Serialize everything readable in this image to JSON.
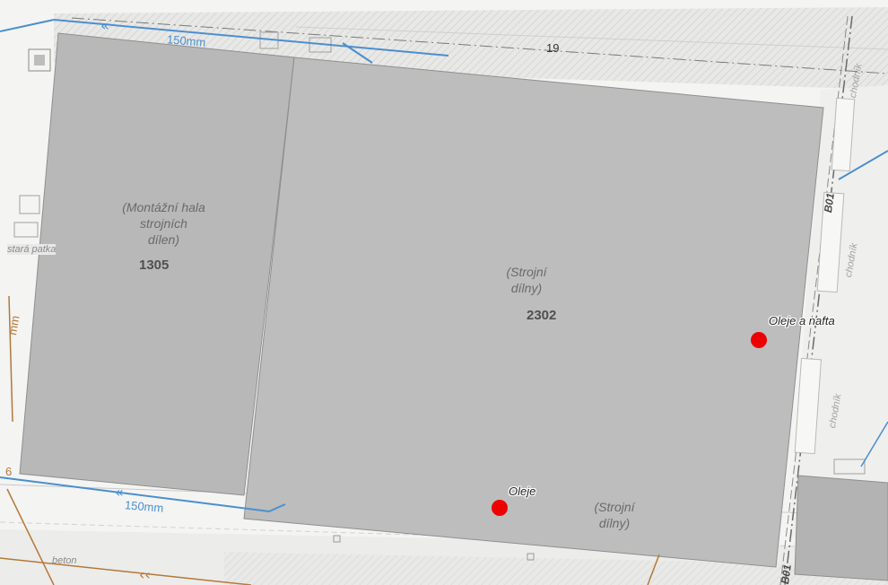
{
  "map": {
    "colors": {
      "background": "#f4f4f2",
      "building": "#b8b8b8",
      "building_edge": "#8f8f8f",
      "pipe_water": "#4a8fd0",
      "pipe_brown": "#b5783a",
      "poi": "#ee0000"
    },
    "buildings": [
      {
        "id": "1305",
        "name": "(Montážní hala strojních dílen)",
        "name_lines": [
          "(Montážní hala",
          "strojních",
          "dílen)"
        ]
      },
      {
        "id": "2302",
        "name": "(Strojní dílny)",
        "name_lines": [
          "(Strojní",
          "dílny)"
        ],
        "secondary_name_lines": [
          "(Strojní",
          "dílny)"
        ]
      }
    ],
    "poi": [
      {
        "label": "Oleje a nafta",
        "icon": "red-dot-marker"
      },
      {
        "label": "Oleje",
        "icon": "red-dot-marker"
      }
    ],
    "pipe_labels": [
      "150mm",
      "150mm"
    ],
    "road_labels": [
      "chodník",
      "chodník",
      "chodník"
    ],
    "line_labels": [
      "B01",
      "B01"
    ],
    "plot_number": "19",
    "other_labels": {
      "stara_patka": "stará patka",
      "beton": "beton",
      "mm": "mm",
      "num6": "6"
    }
  }
}
